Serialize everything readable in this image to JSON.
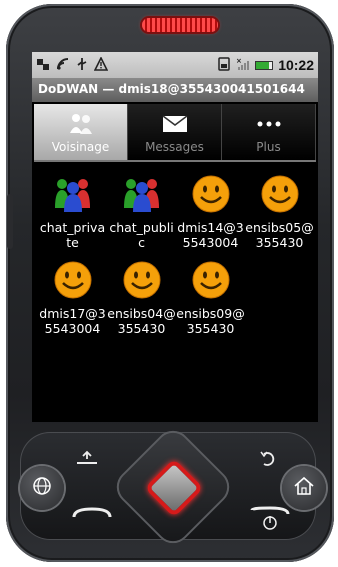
{
  "status_bar": {
    "clock": "10:22",
    "left_icons": [
      "usb-debug-icon",
      "wifi-icon",
      "usb-icon",
      "warning-icon"
    ],
    "right_icons": [
      "sim-icon",
      "signal-icon",
      "battery-icon"
    ]
  },
  "app": {
    "title": "DoDWAN — dmis18@355430041501644"
  },
  "tabs": [
    {
      "label": "Voisinage",
      "icon": "neighbors-icon",
      "active": true
    },
    {
      "label": "Messages",
      "icon": "envelope-icon",
      "active": false
    },
    {
      "label": "Plus",
      "icon": "more-dots-icon",
      "active": false
    }
  ],
  "items": [
    {
      "label": "chat_private",
      "icon": "group-icon"
    },
    {
      "label": "chat_public",
      "icon": "group-icon"
    },
    {
      "label": "dmis14@35543004",
      "icon": "smiley-icon"
    },
    {
      "label": "ensibs05@355430",
      "icon": "smiley-icon"
    },
    {
      "label": "dmis17@35543004",
      "icon": "smiley-icon"
    },
    {
      "label": "ensibs04@355430",
      "icon": "smiley-icon"
    },
    {
      "label": "ensibs09@355430",
      "icon": "smiley-icon"
    }
  ],
  "colors": {
    "speaker": "#e01818",
    "tab_active": "#bdbdbd",
    "title_bar": "#6e6e6e",
    "smiley": "#f5a00a"
  }
}
